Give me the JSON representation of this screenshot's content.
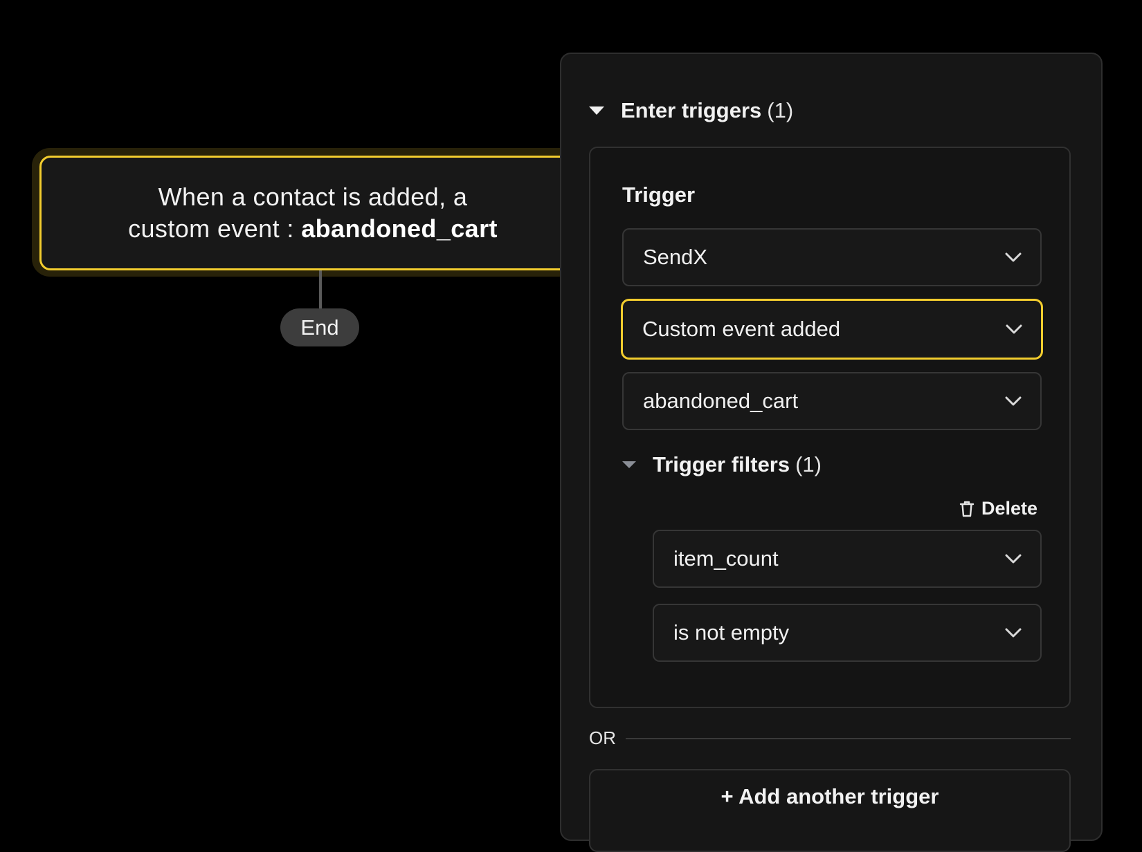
{
  "node": {
    "line1": "When a contact is added, a",
    "line2_prefix": "custom event : ",
    "line2_event": "abandoned_cart",
    "accent": "#f3cd2e"
  },
  "end_label": "End",
  "panel": {
    "section_title": "Enter triggers",
    "section_count": "(1)",
    "trigger_label": "Trigger",
    "selects": {
      "source": "SendX",
      "event_type": "Custom event added",
      "event_name": "abandoned_cart",
      "filter_field": "item_count",
      "filter_operator": "is not empty"
    },
    "filters_title": "Trigger filters",
    "filters_count": "(1)",
    "delete_label": "Delete",
    "or_label": "OR",
    "add_trigger_label": "+ Add another trigger"
  },
  "icons": {
    "section_toggle": "caret-down-icon",
    "select_chevron": "chevron-down-icon",
    "delete": "trash-icon"
  }
}
